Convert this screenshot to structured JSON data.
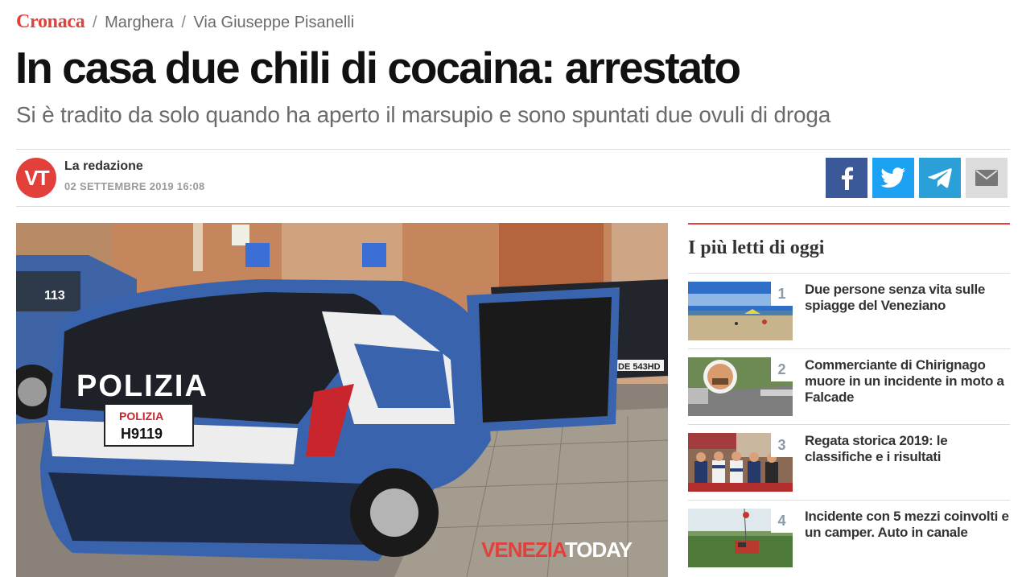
{
  "breadcrumb": {
    "section": "Cronaca",
    "sep1": "/",
    "place": "Marghera",
    "sep2": "/",
    "street": "Via Giuseppe Pisanelli"
  },
  "article": {
    "title": "In casa due chili di cocaina: arrestato",
    "subtitle": "Si è tradito da solo quando ha aperto il marsupio e sono spuntati due ovuli di droga"
  },
  "author": {
    "logo_text": "VT",
    "name": "La redazione",
    "date": "02 SETTEMBRE 2019 16:08"
  },
  "share": {
    "facebook_icon": "facebook-icon",
    "twitter_icon": "twitter-icon",
    "telegram_icon": "telegram-icon",
    "email_icon": "email-icon",
    "colors": {
      "facebook": "#3b5998",
      "twitter": "#1da1f2",
      "telegram": "#2b9fd8",
      "email": "#dcdcdc"
    }
  },
  "photo": {
    "plate_top": "POLIZIA",
    "plate_number": "H9119",
    "car_badge": "POLIZIA",
    "watermark_a": "VENEZIA",
    "watermark_b": "TODAY"
  },
  "sidebar": {
    "title": "I più letti di oggi",
    "items": [
      {
        "rank": "1",
        "title": "Due persone senza vita sulle spiagge del Veneziano"
      },
      {
        "rank": "2",
        "title": "Commerciante di Chirignago muore in un incidente in moto a Falcade"
      },
      {
        "rank": "3",
        "title": "Regata storica 2019: le classifiche e i risultati"
      },
      {
        "rank": "4",
        "title": "Incidente con 5 mezzi coinvolti e un camper. Auto in canale"
      }
    ]
  },
  "colors": {
    "accent": "#e2403b",
    "muted_text": "#6a6a6a",
    "rank_color": "#8a9aa8"
  }
}
